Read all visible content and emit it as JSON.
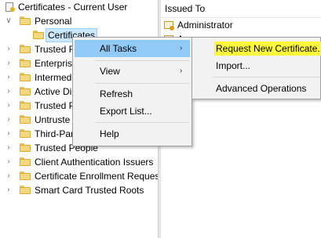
{
  "tree": {
    "root_label": "Certificates - Current User",
    "personal_label": "Personal",
    "certificates_label": "Certificates",
    "items": [
      "Trusted R",
      "Enterprise",
      "Intermed",
      "Active Di",
      "Trusted P",
      "Untruste",
      "Third-Par",
      "Trusted People",
      "Client Authentication Issuers",
      "Certificate Enrollment Reques",
      "Smart Card Trusted Roots"
    ]
  },
  "list": {
    "column_header": "Issued To",
    "rows": [
      "Administrator",
      "A"
    ]
  },
  "context_menu": {
    "items": [
      "All Tasks",
      "View",
      "Refresh",
      "Export List...",
      "Help"
    ]
  },
  "submenu": {
    "items": [
      "Request New Certificate...",
      "Import...",
      "Advanced Operations"
    ]
  },
  "colors": {
    "hover": "#91c9f7",
    "highlight": "#fffb3a",
    "folder": "#f5d77e"
  }
}
